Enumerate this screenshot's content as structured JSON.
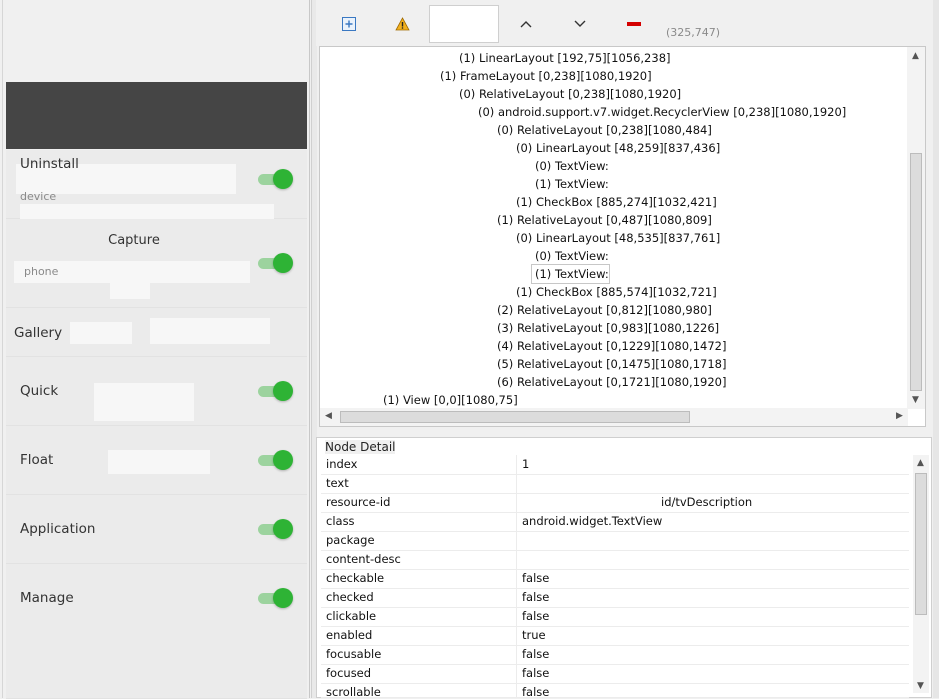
{
  "device_screen": {
    "settings": [
      {
        "label": "Uninstall",
        "sub": "device",
        "toggle": true
      },
      {
        "label": "Capture",
        "sub": "phone",
        "toggle": true
      },
      {
        "label": "Gallery",
        "sub": "",
        "toggle": false
      },
      {
        "label": "Quick",
        "sub": "",
        "toggle": true
      },
      {
        "label": "Float",
        "sub": "",
        "toggle": true
      },
      {
        "label": "Application",
        "sub": "",
        "toggle": true
      },
      {
        "label": "Manage",
        "sub": "",
        "toggle": true
      }
    ]
  },
  "toolbar": {
    "expand_icon": "expand-all-icon",
    "warning_icon": "warning-icon",
    "up_icon": "chevron-up-icon",
    "down_icon": "chevron-down-icon",
    "minus_icon": "red-minus-icon",
    "coords": "(325,747)"
  },
  "tree": {
    "nodes": [
      "(1) LinearLayout [192,75][1056,238]",
      "(1) FrameLayout [0,238][1080,1920]",
      "(0) RelativeLayout [0,238][1080,1920]",
      "(0) android.support.v7.widget.RecyclerView [0,238][1080,1920]",
      "(0) RelativeLayout [0,238][1080,484]",
      "(0) LinearLayout [48,259][837,436]",
      "(0) TextView:",
      "(1) TextView:",
      "(1) CheckBox [885,274][1032,421]",
      "(1) RelativeLayout [0,487][1080,809]",
      "(0) LinearLayout [48,535][837,761]",
      "(0) TextView:",
      "(1) TextView:",
      "(1) CheckBox [885,574][1032,721]",
      "(2) RelativeLayout [0,812][1080,980]",
      "(3) RelativeLayout [0,983][1080,1226]",
      "(4) RelativeLayout [0,1229][1080,1472]",
      "(5) RelativeLayout [0,1475][1080,1718]",
      "(6) RelativeLayout [0,1721][1080,1920]",
      "(1) View [0,0][1080,75]"
    ],
    "selected_index": 12
  },
  "detail": {
    "title": "Node Detail",
    "rows": [
      {
        "key": "index",
        "value": "1"
      },
      {
        "key": "text",
        "value": ""
      },
      {
        "key": "resource-id",
        "value": "id/tvDescription"
      },
      {
        "key": "class",
        "value": "android.widget.TextView"
      },
      {
        "key": "package",
        "value": ""
      },
      {
        "key": "content-desc",
        "value": ""
      },
      {
        "key": "checkable",
        "value": "false"
      },
      {
        "key": "checked",
        "value": "false"
      },
      {
        "key": "clickable",
        "value": "false"
      },
      {
        "key": "enabled",
        "value": "true"
      },
      {
        "key": "focusable",
        "value": "false"
      },
      {
        "key": "focused",
        "value": "false"
      },
      {
        "key": "scrollable",
        "value": "false"
      }
    ]
  },
  "colors": {
    "toggle_on": "#2eb335",
    "header_dark": "#454545",
    "warning": "#e8a317",
    "minus": "#d40000"
  }
}
